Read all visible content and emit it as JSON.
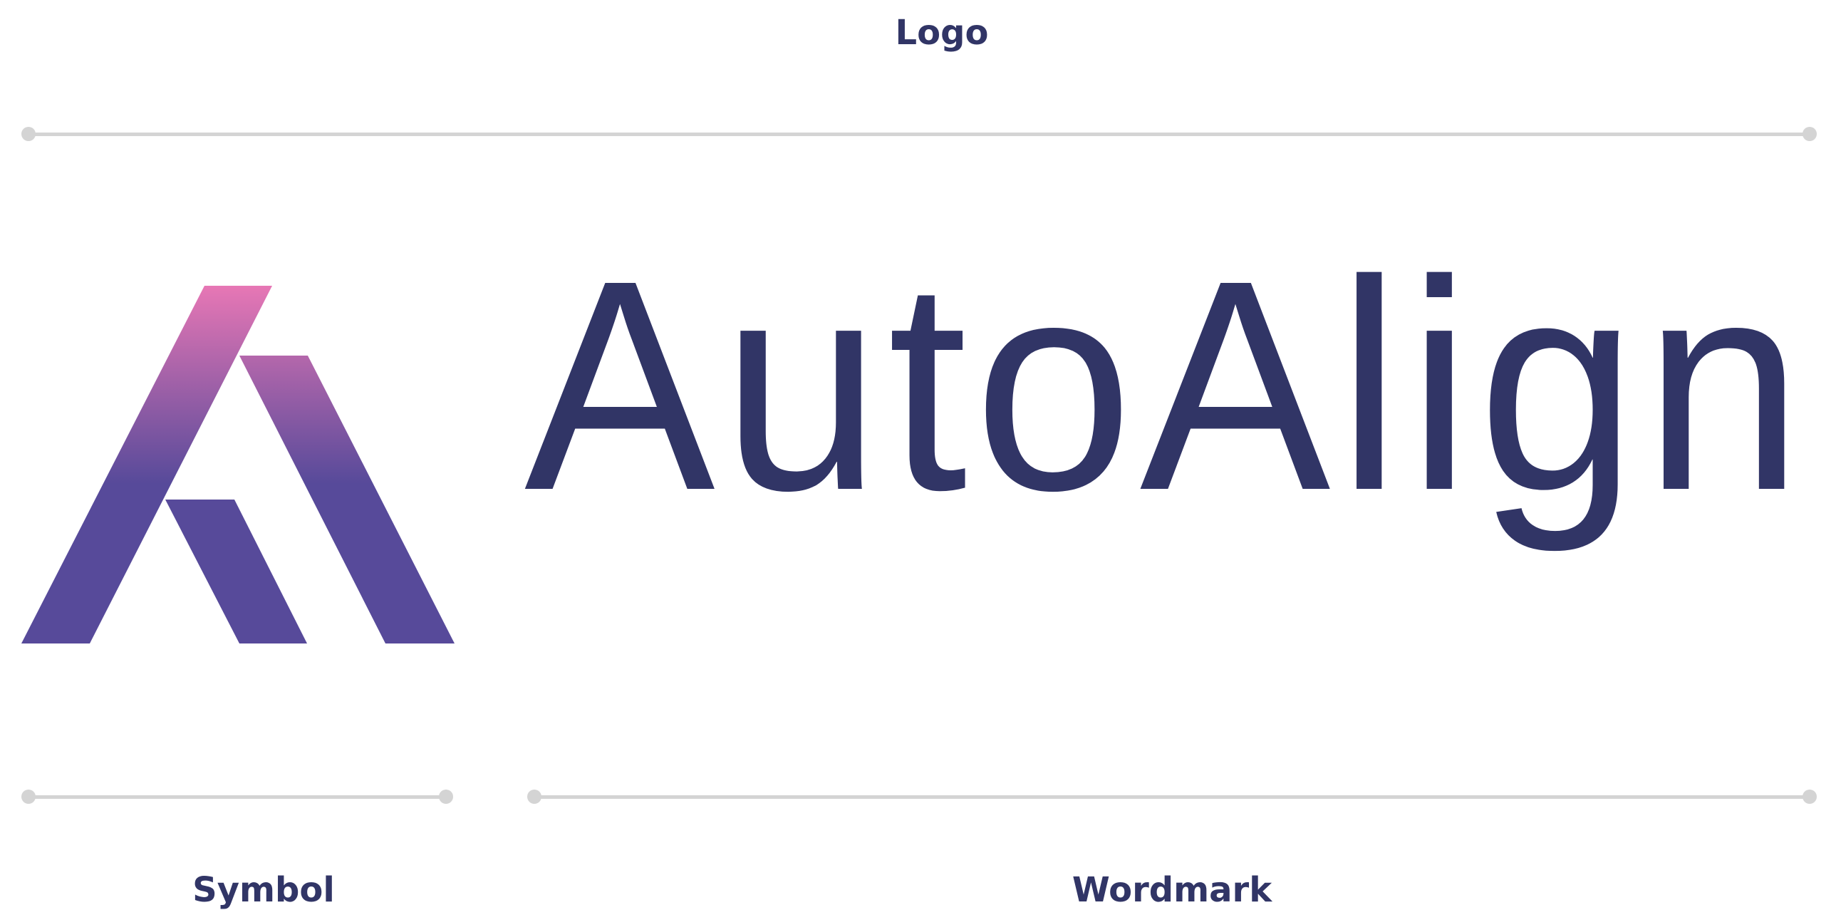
{
  "captions": {
    "logo": "Logo",
    "symbol": "Symbol",
    "wordmark": "Wordmark"
  },
  "wordmark_text": "AutoAlign",
  "colors": {
    "text": "#313566",
    "dimension_line": "#d4d4d4",
    "gradient_top": "#e777b5",
    "gradient_bottom": "#574a9a"
  }
}
